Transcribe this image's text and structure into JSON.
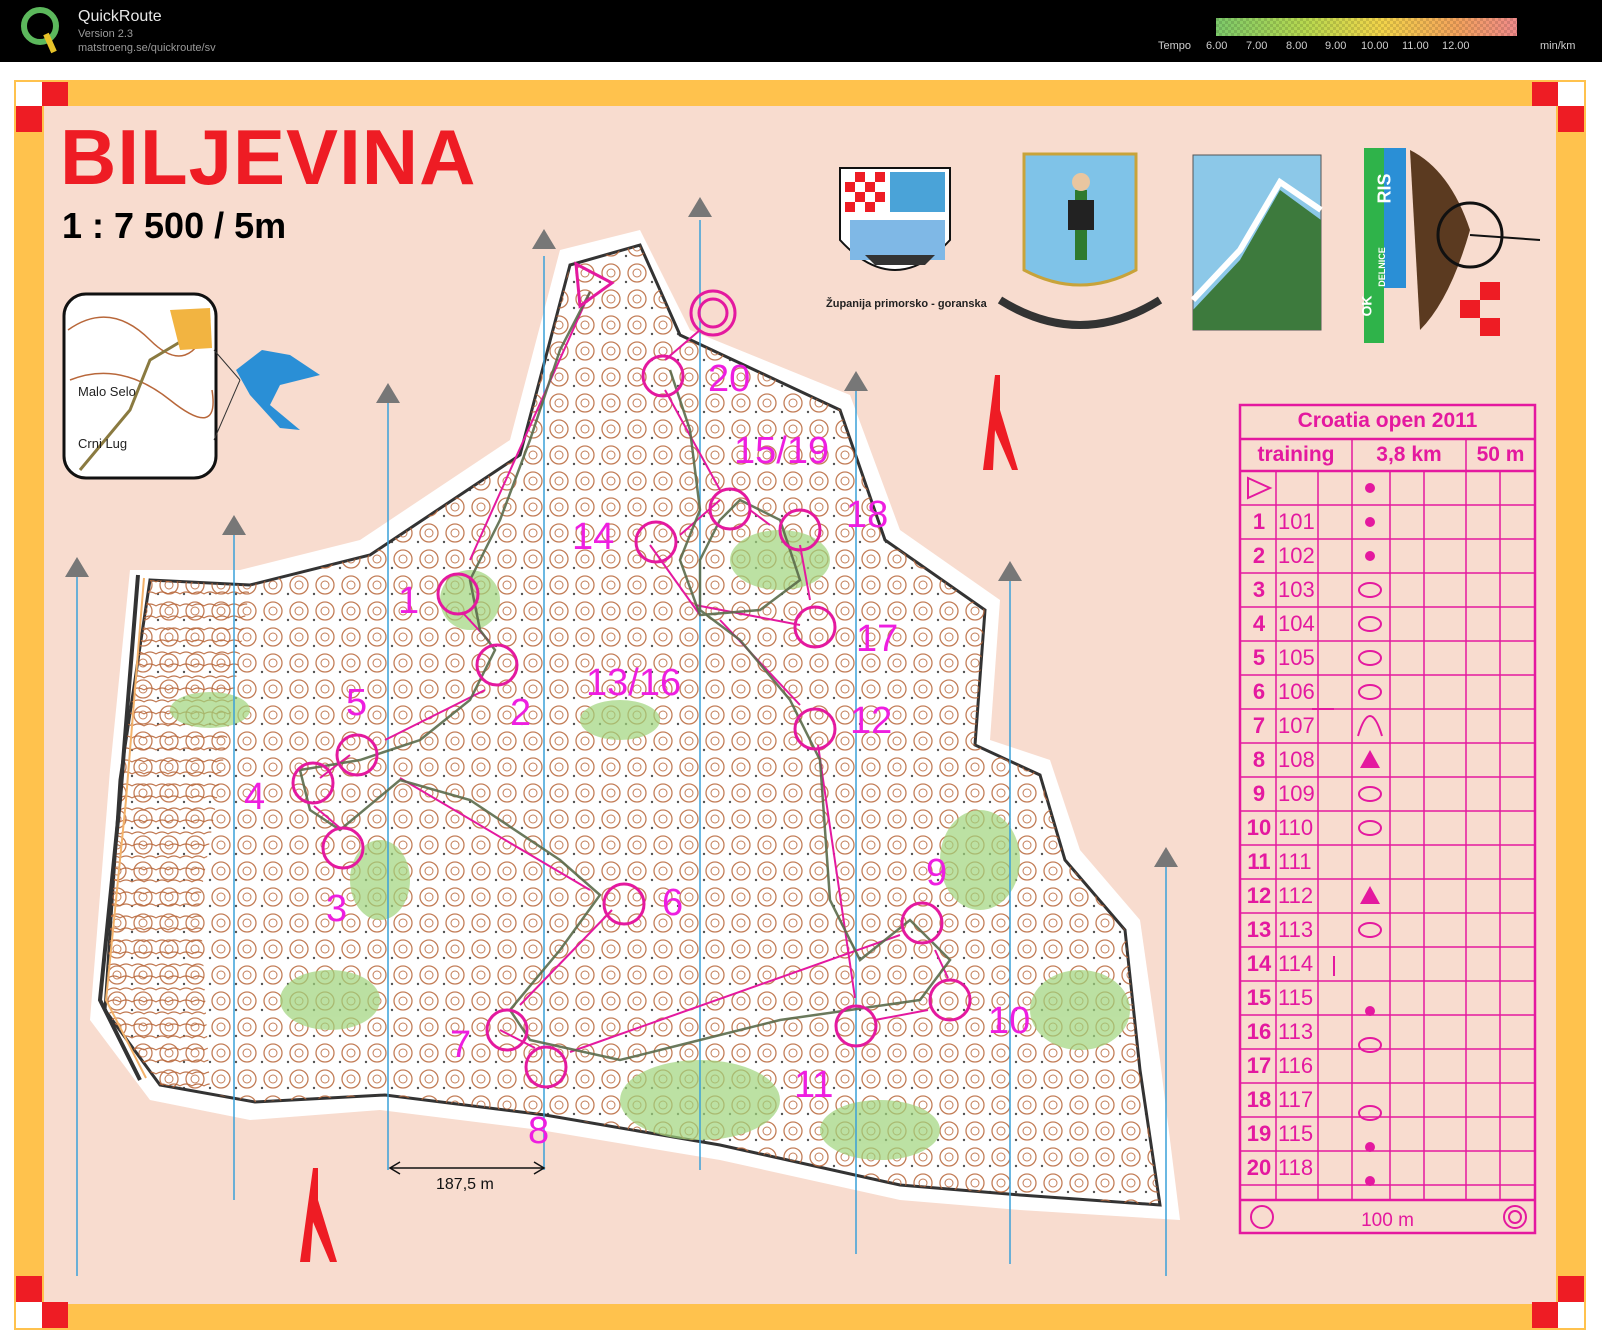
{
  "app": {
    "name": "QuickRoute",
    "version": "Version 2.3",
    "url": "matstroeng.se/quickroute/sv"
  },
  "tempo": {
    "label": "Tempo",
    "ticks": [
      "6.00",
      "7.00",
      "8.00",
      "9.00",
      "10.00",
      "11.00",
      "12.00"
    ],
    "unit": "min/km",
    "colors": [
      "#7cc96a",
      "#b7d84f",
      "#f2d44a",
      "#f3a35c",
      "#ef8a8a"
    ]
  },
  "map": {
    "title": "BILJEVINA",
    "scale": "1 : 7 500 / 5m",
    "scalebar": "187,5 m",
    "county_text": "Županija primorsko - goranska",
    "club_logo_text": [
      "OK",
      "RIS",
      "DELNICE"
    ],
    "inset_labels": [
      "Malo Selo",
      "Crni Lug"
    ],
    "colors": {
      "frame": "#ffc24d",
      "paper": "#f8dccf",
      "title_red": "#ee1c24",
      "course": "#e4199f",
      "magnetic_line": "#3aa0d8",
      "route": "#5a6a4a"
    }
  },
  "controls": [
    {
      "label": "1"
    },
    {
      "label": "2"
    },
    {
      "label": "3"
    },
    {
      "label": "4"
    },
    {
      "label": "5"
    },
    {
      "label": "6"
    },
    {
      "label": "7"
    },
    {
      "label": "8"
    },
    {
      "label": "9"
    },
    {
      "label": "10"
    },
    {
      "label": "11"
    },
    {
      "label": "12"
    },
    {
      "label": "13/16"
    },
    {
      "label": "14"
    },
    {
      "label": "15/19"
    },
    {
      "label": "17"
    },
    {
      "label": "18"
    },
    {
      "label": "20"
    }
  ],
  "course": {
    "title": "Croatia open 2011",
    "class": "training",
    "length": "3,8 km",
    "climb": "50 m",
    "rows": [
      {
        "n": "1",
        "code": "101"
      },
      {
        "n": "2",
        "code": "102"
      },
      {
        "n": "3",
        "code": "103"
      },
      {
        "n": "4",
        "code": "104"
      },
      {
        "n": "5",
        "code": "105"
      },
      {
        "n": "6",
        "code": "106"
      },
      {
        "n": "7",
        "code": "107"
      },
      {
        "n": "8",
        "code": "108"
      },
      {
        "n": "9",
        "code": "109"
      },
      {
        "n": "10",
        "code": "110"
      },
      {
        "n": "11",
        "code": "111"
      },
      {
        "n": "12",
        "code": "112"
      },
      {
        "n": "13",
        "code": "113"
      },
      {
        "n": "14",
        "code": "114"
      },
      {
        "n": "15",
        "code": "115"
      },
      {
        "n": "16",
        "code": "113"
      },
      {
        "n": "17",
        "code": "116"
      },
      {
        "n": "18",
        "code": "117"
      },
      {
        "n": "19",
        "code": "115"
      },
      {
        "n": "20",
        "code": "118"
      }
    ],
    "finish": "100 m"
  }
}
